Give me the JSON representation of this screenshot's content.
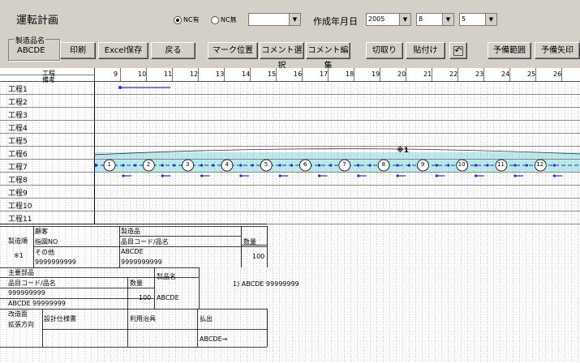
{
  "window_title": "運転計画",
  "nc": {
    "with_label": "NC有",
    "without_label": "NC無",
    "selected": "with"
  },
  "filter_combo": {
    "value": ""
  },
  "date": {
    "label": "作成年月日",
    "year": "2005",
    "month": "8",
    "day": "5"
  },
  "product": {
    "group_label": "製造品名",
    "value": "ABCDE"
  },
  "toolbar": {
    "print": "印刷",
    "excel": "Excel保存",
    "back": "戻る",
    "mark_pos": "マーク位置",
    "comment_select": "コメント選択",
    "comment_edit": "コメント編集",
    "cut": "切取り",
    "paste": "貼付け",
    "undo_icon": "undo-icon",
    "reserve_range": "予備範囲",
    "reserve_arrow": "予備矢印"
  },
  "schedule": {
    "header_top": "工程",
    "header_bottom": "備考",
    "days": [
      "9",
      "10",
      "11",
      "12",
      "13",
      "14",
      "15",
      "16",
      "17",
      "18",
      "19",
      "20",
      "21",
      "22",
      "23",
      "24",
      "25",
      "26"
    ],
    "processes": [
      "工程1",
      "工程2",
      "工程3",
      "工程4",
      "工程5",
      "工程6",
      "工程7",
      "工程8",
      "工程9",
      "工程10",
      "工程11"
    ],
    "annotation": "※1",
    "process7_markers": [
      "1",
      "2",
      "3",
      "4",
      "5",
      "6",
      "7",
      "8",
      "9",
      "10",
      "11",
      "12"
    ],
    "highlight_color": "#b8ecec",
    "line_color": "#2a2ad0"
  },
  "info_table": {
    "seizou_jun": "製造順",
    "kokyaku": "顧客",
    "shizu_no": "指図NO",
    "seizouhin": "製造品",
    "hinmoku_code_name": "品目コード/品名",
    "suryo": "数量",
    "row_mark": "※1",
    "sonota": "その他",
    "code1": "9999999999",
    "product_name": "ABCDE",
    "code2": "9999999999",
    "qty1": "100",
    "shuyo_buhin": "主要部品",
    "hinmoku2": "品目コード/品名",
    "suryo2": "数量",
    "seizouhinmei": "製品名",
    "code3": "999999999",
    "abcde_code": "ABCDE 99999999",
    "qty2": "100",
    "abcde2": "ABCDE",
    "note_line": "1) ABCDE  99999999",
    "kaizou_men": "改造面",
    "kakuchou_houkou": "拡張方向",
    "sekkei_shiyousho": "設計仕様書",
    "riyou_jigu": "利用治具",
    "haraidashi": "払出",
    "haraidashi_value": "ABCDE→"
  }
}
